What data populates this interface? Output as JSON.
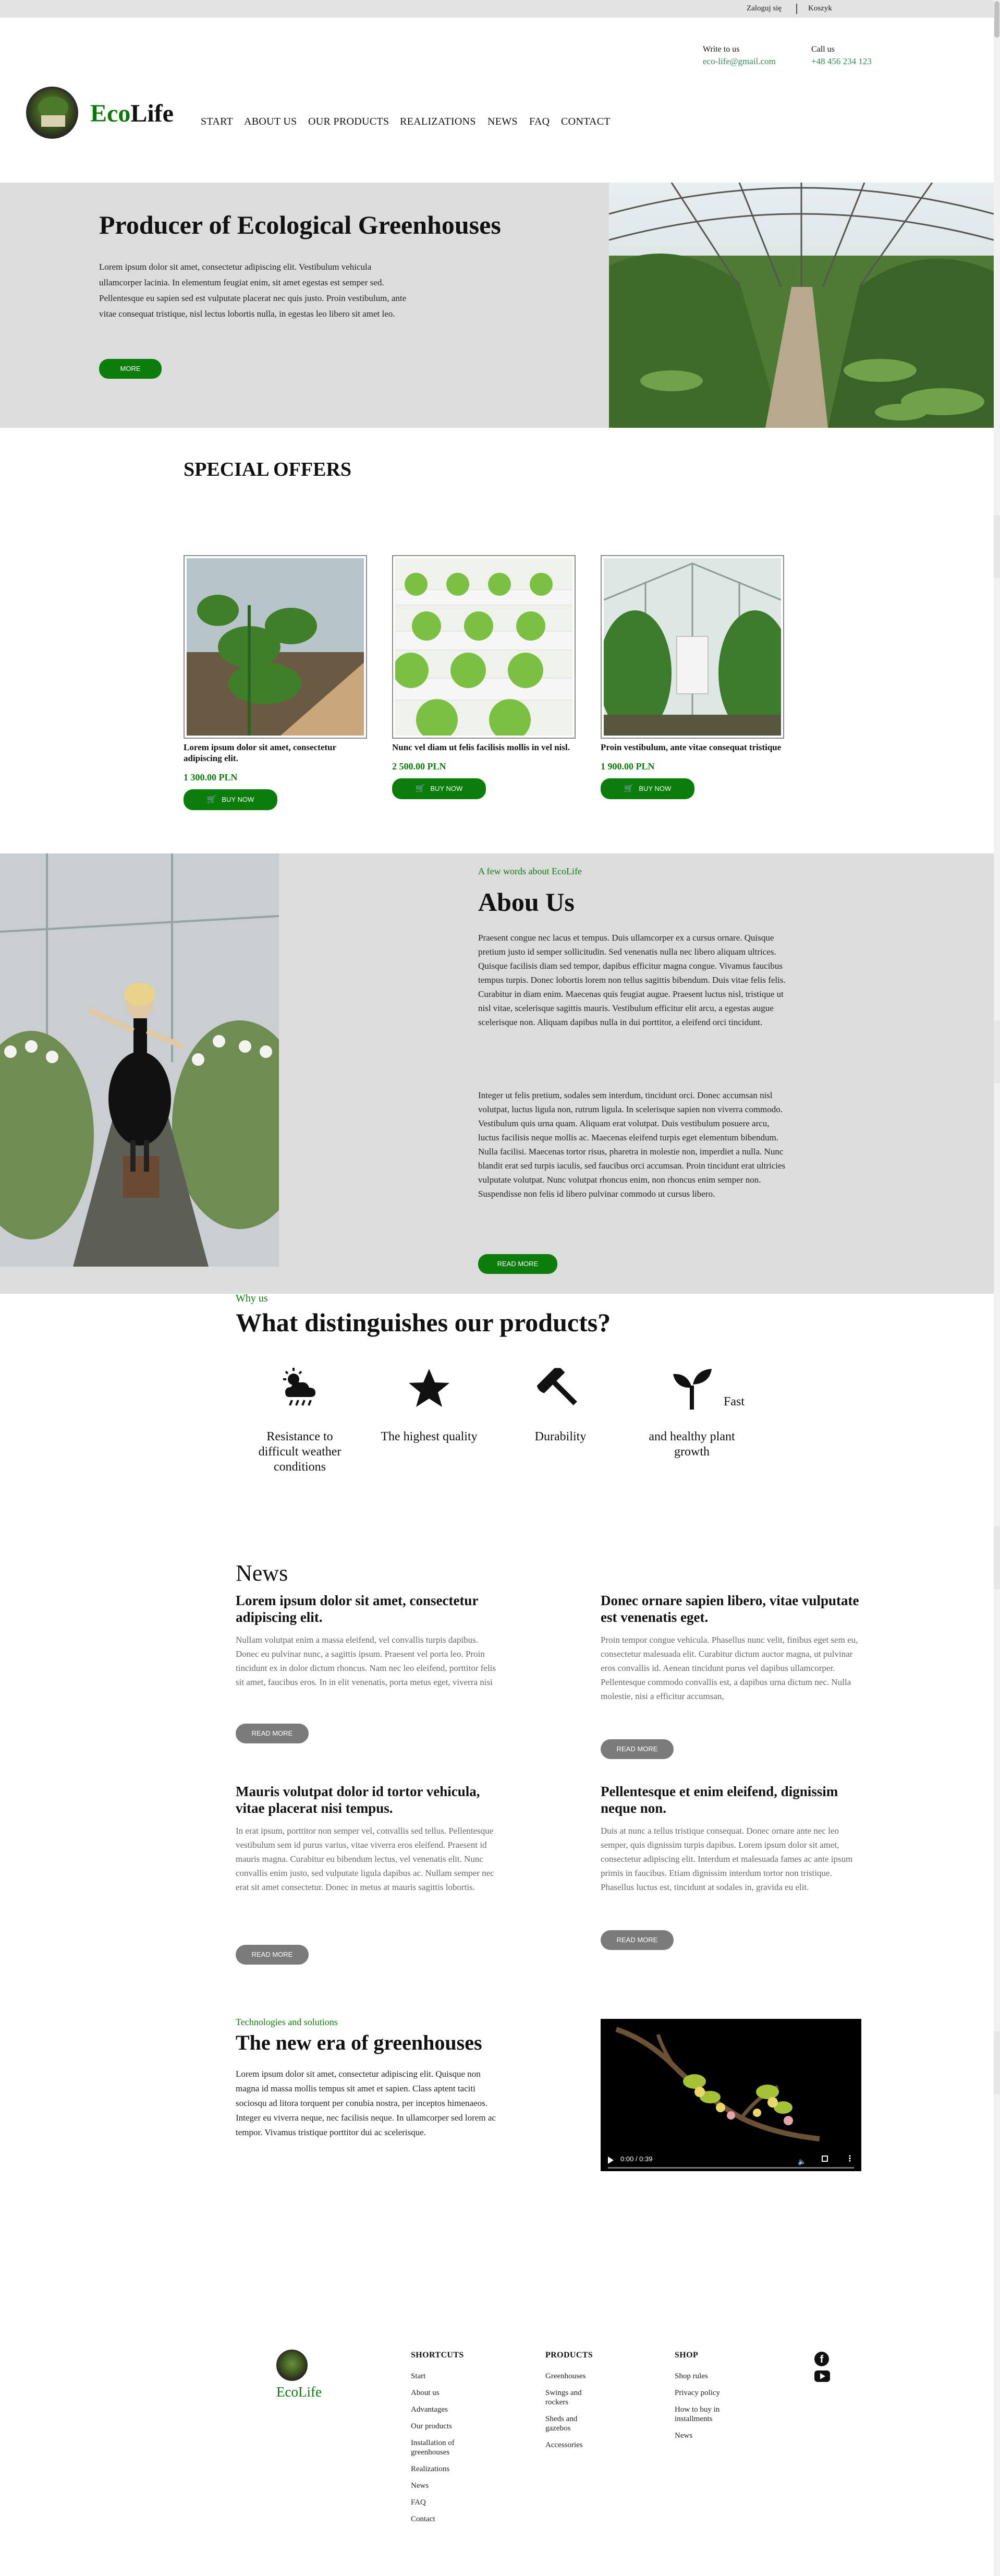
{
  "topbar": {
    "login": "Zaloguj się",
    "cart": "Koszyk"
  },
  "header": {
    "write_label": "Write to us",
    "email": "eco-life@gmail.com",
    "call_label": "Call us",
    "phone": "+48 456 234 123",
    "logo_eco": "Eco",
    "logo_life": "Life",
    "nav": [
      "START",
      "ABOUT US",
      "OUR PRODUCTS",
      "REALIZATIONS",
      "NEWS",
      "FAQ",
      "CONTACT"
    ]
  },
  "hero": {
    "title": "Producer of Ecological Greenhouses",
    "text": "Lorem ipsum dolor sit amet, consectetur adipiscing elit. Vestibulum vehicula ullamcorper lacinia. In elementum feugiat enim, sit amet egestas est semper sed. Pellentesque eu sapien sed est vulputate placerat nec quis justo. Proin vestibulum, ante vitae consequat tristique, nisl lectus lobortis nulla, in egestas leo libero sit amet leo.",
    "button": "MORE"
  },
  "offers": {
    "title": "SPECIAL OFFERS",
    "buy_label": "BUY NOW",
    "products": [
      {
        "name": "Lorem ipsum dolor sit amet, consectetur adipiscing elit.",
        "price": "1 300.00 PLN"
      },
      {
        "name": "Nunc vel diam ut felis facilisis mollis in vel nisl.",
        "price": "2 500.00 PLN"
      },
      {
        "name": "Proin vestibulum, ante vitae consequat tristique",
        "price": "1 900.00 PLN"
      }
    ]
  },
  "about": {
    "kicker": "A few words about EcoLife",
    "title": "Abou Us",
    "p1": "Praesent congue nec lacus et tempus. Duis ullamcorper ex a cursus ornare. Quisque pretium justo id semper sollicitudin. Sed venenatis nulla nec libero aliquam ultrices. Quisque facilisis diam sed tempor, dapibus efficitur magna congue. Vivamus faucibus tempus turpis. Donec lobortis lorem non tellus sagittis bibendum. Duis vitae felis felis. Curabitur in diam enim. Maecenas quis feugiat augue. Praesent luctus nisl, tristique ut nisl vitae, scelerisque sagittis mauris. Vestibulum efficitur elit arcu, a egestas augue scelerisque non. Aliquam dapibus nulla in dui porttitor, a eleifend orci tincidunt.",
    "p2": "Integer ut felis pretium, sodales sem interdum, tincidunt orci. Donec accumsan nisl volutpat, luctus ligula non, rutrum ligula. In scelerisque sapien non viverra commodo. Vestibulum quis urna quam. Aliquam erat volutpat. Duis vestibulum posuere arcu, luctus facilisis neque mollis ac. Maecenas eleifend turpis eget elementum bibendum. Nulla facilisi. Maecenas tortor risus, pharetra in molestie non, imperdiet a nulla. Nunc blandit erat sed turpis iaculis, sed faucibus orci accumsan. Proin tincidunt erat ultricies vulputate volutpat. Nunc volutpat rhoncus enim, non rhoncus enim semper non. Suspendisse non felis id libero pulvinar commodo ut cursus libero.",
    "button": "READ MORE"
  },
  "why": {
    "kicker": "Why us",
    "title": "What distinguishes our products?",
    "features": [
      {
        "icon": "weather-icon",
        "label": "Resistance to difficult weather conditions"
      },
      {
        "icon": "star-icon",
        "label": "The highest quality"
      },
      {
        "icon": "hammer-icon",
        "label": "Durability"
      },
      {
        "icon": "sprout-icon",
        "label": "and healthy plant growth",
        "extra": "Fast"
      }
    ]
  },
  "news": {
    "title": "News",
    "button": "READ MORE",
    "items": [
      {
        "title": "Lorem ipsum dolor sit amet, consectetur adipiscing elit.",
        "text": "Nullam volutpat enim a massa eleifend, vel convallis turpis dapibus. Donec eu pulvinar nunc, a sagittis ipsum. Praesent vel porta leo. Proin tincidunt ex in dolor dictum rhoncus. Nam nec leo eleifend, porttitor felis sit amet, faucibus eros. In in elit venenatis, porta metus eget, viverra nisi"
      },
      {
        "title": "Donec ornare sapien libero, vitae vulputate est venenatis eget.",
        "text": "Proin tempor congue vehicula. Phasellus nunc velit, finibus eget sem eu, consectetur malesuada elit. Curabitur dictum auctor magna, ut pulvinar eros convallis id. Aenean tincidunt purus vel dapibus ullamcorper. Pellentesque commodo convallis est, a dapibus urna dictum nec. Nulla molestie, nisi a efficitur accumsan,"
      },
      {
        "title": "Mauris volutpat dolor id tortor vehicula, vitae placerat nisi tempus.",
        "text": "In erat ipsum, porttitor non semper vel, convallis sed tellus. Pellentesque vestibulum sem id purus varius, vitae viverra eros eleifend. Praesent id mauris magna. Curabitur eu bibendum lectus, vel venenatis elit. Nunc convallis enim justo, sed vulputate ligula dapibus ac. Nullam semper nec erat sit amet consectetur. Donec in metus at mauris sagittis lobortis."
      },
      {
        "title": "Pellentesque et enim eleifend, dignissim neque non.",
        "text": "Duis at nunc a tellus tristique consequat. Donec ornare ante nec leo semper, quis dignissim turpis dapibus. Lorem ipsum dolor sit amet, consectetur adipiscing elit. Interdum et malesuada fames ac ante ipsum primis in faucibus. Etiam dignissim interdum tortor non tristique. Phasellus luctus est, tincidunt at sodales in, gravida eu elit."
      }
    ]
  },
  "tech": {
    "kicker": "Technologies and solutions",
    "title": "The new era of greenhouses",
    "text": "Lorem ipsum dolor sit amet, consectetur adipiscing elit. Quisque non magna id massa mollis tempus sit amet et sapien. Class aptent taciti sociosqu ad litora torquent per conubia nostra, per inceptos himenaeos. Integer eu viverra neque, nec facilisis neque. In ullamcorper sed lorem ac tempor. Vivamus tristique porttitor dui ac scelerisque.",
    "video_time": "0:00 / 0:39"
  },
  "footer": {
    "logo_eco": "Eco",
    "logo_life": "Life",
    "columns": [
      {
        "title": "SHORTCUTS",
        "links": [
          "Start",
          "About us",
          "Advantages",
          "Our products",
          "Installation of greenhouses",
          "Realizations",
          "News",
          "FAQ",
          "Contact"
        ]
      },
      {
        "title": "PRODUCTS",
        "links": [
          "Greenhouses",
          "Swings and rockers",
          "Sheds and gazebos",
          "Accessories"
        ]
      },
      {
        "title": "SHOP",
        "links": [
          "Shop rules",
          "Privacy policy",
          "How to buy in installments",
          "News"
        ]
      }
    ]
  },
  "colors": {
    "accent": "#0b7d0b",
    "gray_bg": "#dcdcdc",
    "button_gray": "#7b7b7b"
  }
}
